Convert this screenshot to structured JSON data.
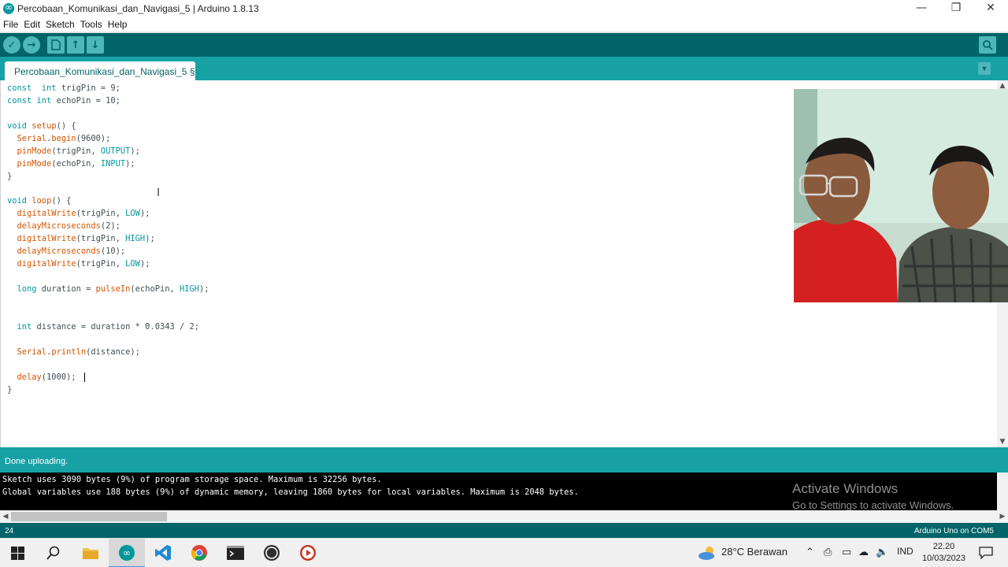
{
  "window": {
    "title": "Percobaan_Komunikasi_dan_Navigasi_5 | Arduino 1.8.13",
    "controls": {
      "minimize": "—",
      "restore": "❐",
      "close": "✕"
    }
  },
  "menu": {
    "items": [
      "File",
      "Edit",
      "Sketch",
      "Tools",
      "Help"
    ]
  },
  "toolbar": {
    "verify_icon": "check-icon",
    "upload_icon": "arrow-right-icon",
    "new_icon": "file-icon",
    "open_icon": "arrow-up-icon",
    "save_icon": "arrow-down-icon",
    "serial_icon": "magnifier-icon"
  },
  "tab": {
    "label": "Percobaan_Komunikasi_dan_Navigasi_5 §"
  },
  "code": {
    "lines": [
      [
        [
          "kw-type",
          "const"
        ],
        [
          "",
          "  "
        ],
        [
          "kw-type",
          "int"
        ],
        [
          "",
          " trigPin = 9;"
        ]
      ],
      [
        [
          "kw-type",
          "const"
        ],
        [
          "",
          " "
        ],
        [
          "kw-type",
          "int"
        ],
        [
          "",
          " echoPin = 10;"
        ]
      ],
      [],
      [
        [
          "kw-type",
          "void"
        ],
        [
          "",
          " "
        ],
        [
          "kw-fn",
          "setup"
        ],
        [
          "",
          "() {"
        ]
      ],
      [
        [
          "",
          "  "
        ],
        [
          "kw-fn",
          "Serial"
        ],
        [
          "",
          "."
        ],
        [
          "kw-fn",
          "begin"
        ],
        [
          "",
          "(9600);"
        ]
      ],
      [
        [
          "",
          "  "
        ],
        [
          "kw-fn",
          "pinMode"
        ],
        [
          "",
          "(trigPin, "
        ],
        [
          "kw-const",
          "OUTPUT"
        ],
        [
          "",
          ");"
        ]
      ],
      [
        [
          "",
          "  "
        ],
        [
          "kw-fn",
          "pinMode"
        ],
        [
          "",
          "(echoPin, "
        ],
        [
          "kw-const",
          "INPUT"
        ],
        [
          "",
          ");"
        ]
      ],
      [
        [
          "",
          "}"
        ]
      ],
      [],
      [
        [
          "kw-type",
          "void"
        ],
        [
          "",
          " "
        ],
        [
          "kw-fn",
          "loop"
        ],
        [
          "",
          "() {"
        ]
      ],
      [
        [
          "",
          "  "
        ],
        [
          "kw-fn",
          "digitalWrite"
        ],
        [
          "",
          "(trigPin, "
        ],
        [
          "kw-const",
          "LOW"
        ],
        [
          "",
          ");"
        ]
      ],
      [
        [
          "",
          "  "
        ],
        [
          "kw-fn",
          "delayMicroseconds"
        ],
        [
          "",
          "(2);"
        ]
      ],
      [
        [
          "",
          "  "
        ],
        [
          "kw-fn",
          "digitalWrite"
        ],
        [
          "",
          "(trigPin, "
        ],
        [
          "kw-const",
          "HIGH"
        ],
        [
          "",
          ");"
        ]
      ],
      [
        [
          "",
          "  "
        ],
        [
          "kw-fn",
          "delayMicroseconds"
        ],
        [
          "",
          "(10);"
        ]
      ],
      [
        [
          "",
          "  "
        ],
        [
          "kw-fn",
          "digitalWrite"
        ],
        [
          "",
          "(trigPin, "
        ],
        [
          "kw-const",
          "LOW"
        ],
        [
          "",
          ");"
        ]
      ],
      [],
      [
        [
          "",
          "  "
        ],
        [
          "kw-type",
          "long"
        ],
        [
          "",
          " duration = "
        ],
        [
          "kw-fn",
          "pulseIn"
        ],
        [
          "",
          "(echoPin, "
        ],
        [
          "kw-const",
          "HIGH"
        ],
        [
          "",
          ");"
        ]
      ],
      [],
      [],
      [
        [
          "",
          "  "
        ],
        [
          "kw-type",
          "int"
        ],
        [
          "",
          " distance = duration * 0.0343 / 2;"
        ]
      ],
      [],
      [
        [
          "",
          "  "
        ],
        [
          "kw-fn",
          "Serial"
        ],
        [
          "",
          "."
        ],
        [
          "kw-fn",
          "println"
        ],
        [
          "",
          "(distance);"
        ]
      ],
      [],
      [
        [
          "",
          "  "
        ],
        [
          "kw-fn",
          "delay"
        ],
        [
          "",
          "(1000); "
        ]
      ],
      [
        [
          "",
          "}"
        ]
      ]
    ]
  },
  "status": {
    "text": "Done uploading."
  },
  "console": {
    "lines": [
      "Sketch uses 3090 bytes (9%) of program storage space. Maximum is 32256 bytes.",
      "Global variables use 188 bytes (9%) of dynamic memory, leaving 1860 bytes for local variables. Maximum is 2048 bytes."
    ]
  },
  "watermark": {
    "title": "Activate Windows",
    "subtitle": "Go to Settings to activate Windows."
  },
  "infobar": {
    "line_number": "24",
    "board": "Arduino Uno on COM5"
  },
  "taskbar": {
    "weather": "28°C  Berawan",
    "language": "IND",
    "time": "22.20",
    "date": "10/03/2023",
    "colors": {
      "accent": "#4a90d9"
    }
  },
  "colors": {
    "teal_dark": "#006468",
    "teal": "#17a1a5",
    "teal_light": "#4db7bb",
    "keyword": "#00979c",
    "function": "#d35400"
  }
}
